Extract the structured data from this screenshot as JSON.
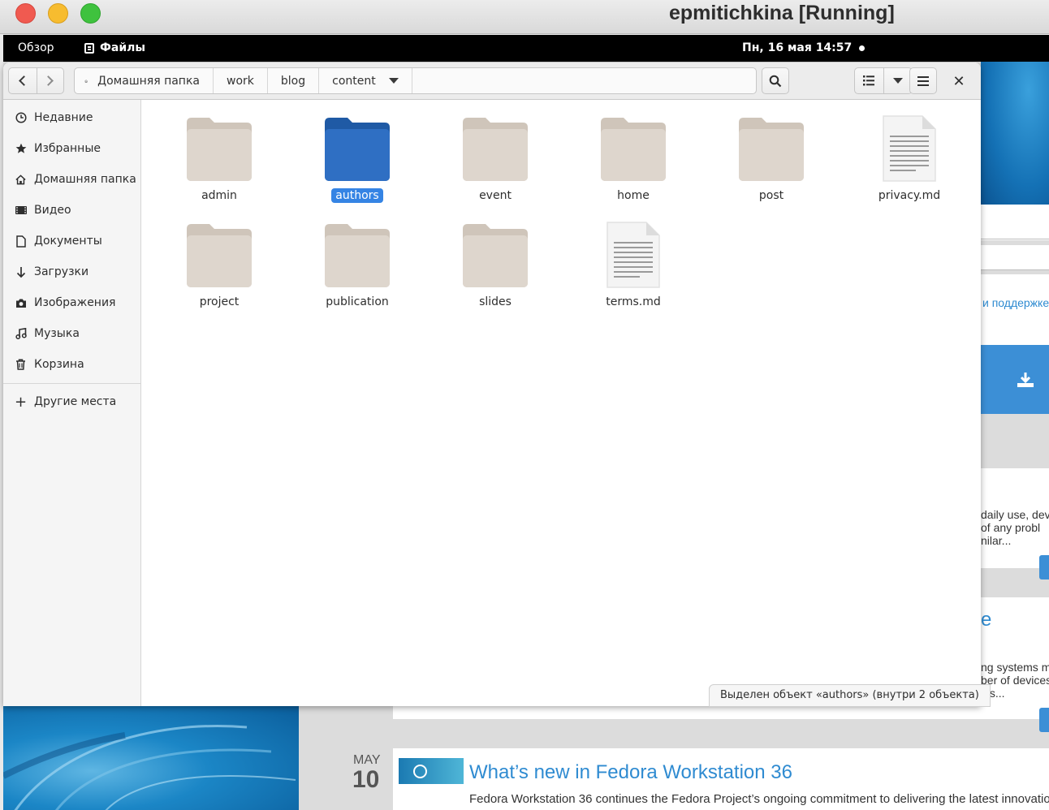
{
  "host": {
    "vm_title": "epmitichkina [Running]"
  },
  "topbar": {
    "overview_label": "Обзор",
    "app_label": "Файлы",
    "clock": "Пн, 16 мая  14:57"
  },
  "headerbar": {
    "breadcrumbs": [
      "Домашняя папка",
      "work",
      "blog",
      "content"
    ],
    "icons": [
      "back-icon",
      "forward-icon",
      "home-icon",
      "dropdown-icon",
      "search-icon",
      "list-view-icon",
      "view-options-icon",
      "hamburger-menu-icon",
      "close-icon"
    ]
  },
  "sidebar": {
    "items": [
      {
        "label": "Недавние",
        "icon": "clock-icon"
      },
      {
        "label": "Избранные",
        "icon": "star-icon"
      },
      {
        "label": "Домашняя папка",
        "icon": "home-icon"
      },
      {
        "label": "Видео",
        "icon": "video-icon"
      },
      {
        "label": "Документы",
        "icon": "document-icon"
      },
      {
        "label": "Загрузки",
        "icon": "download-icon"
      },
      {
        "label": "Изображения",
        "icon": "camera-icon"
      },
      {
        "label": "Музыка",
        "icon": "music-icon"
      },
      {
        "label": "Корзина",
        "icon": "trash-icon"
      }
    ],
    "other_places": {
      "label": "Другие места",
      "icon": "plus-icon"
    }
  },
  "files": [
    {
      "name": "admin",
      "type": "folder",
      "selected": false
    },
    {
      "name": "authors",
      "type": "folder",
      "selected": true
    },
    {
      "name": "event",
      "type": "folder",
      "selected": false
    },
    {
      "name": "home",
      "type": "folder",
      "selected": false
    },
    {
      "name": "post",
      "type": "folder",
      "selected": false
    },
    {
      "name": "privacy.md",
      "type": "document",
      "selected": false
    },
    {
      "name": "project",
      "type": "folder",
      "selected": false
    },
    {
      "name": "publication",
      "type": "folder",
      "selected": false
    },
    {
      "name": "slides",
      "type": "folder",
      "selected": false
    },
    {
      "name": "terms.md",
      "type": "document",
      "selected": false
    }
  ],
  "status": "Выделен объект «authors»  (внутри 2 объекта)",
  "background_page": {
    "snippet_support": "и поддержке",
    "snippet_a1": "daily use, dev",
    "snippet_a2": "of any probl",
    "snippet_a3": "nilar...",
    "snippet_b0": "e",
    "snippet_b1": "ng systems m",
    "snippet_b2": "ber of devices",
    "snippet_b3": "t is...",
    "date_month": "MAY",
    "date_day": "10",
    "headline": "What’s new in Fedora Workstation 36",
    "teaser": "Fedora Workstation 36 continues the Fedora Project’s ongoing commitment to delivering the latest innovation"
  },
  "colors": {
    "selection": "#3584e4",
    "folder": "#ded6cd",
    "folder_selected": "#2f6fc3",
    "link": "#2f8bd1"
  }
}
